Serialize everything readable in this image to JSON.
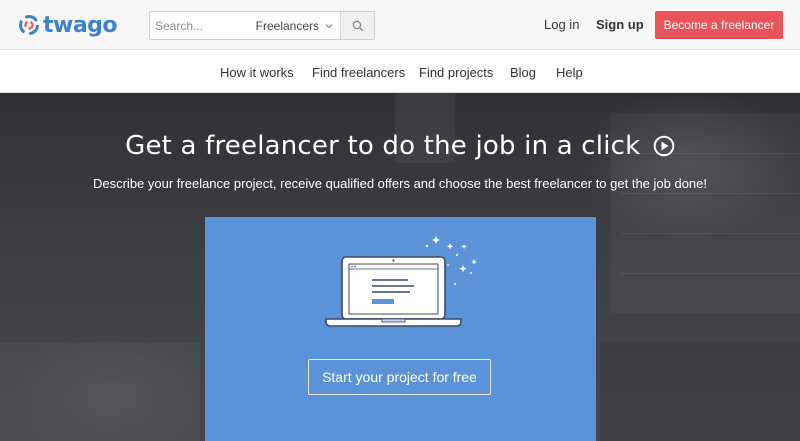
{
  "header": {
    "logo_text": "twago",
    "search": {
      "placeholder": "Search...",
      "category": "Freelancers"
    },
    "login": "Log in",
    "signup": "Sign up",
    "become_freelancer": "Become a freelancer"
  },
  "nav": {
    "items": [
      "How it works",
      "Find freelancers",
      "Find projects",
      "Blog",
      "Help"
    ]
  },
  "hero": {
    "title": "Get a freelancer to do the job in a click",
    "subtitle": "Describe your freelance project, receive qualified offers and choose the best freelancer to get the job done!",
    "cta": "Start your project for free"
  },
  "colors": {
    "brand_blue": "#3f82c9",
    "accent_red": "#e8545a",
    "card_blue": "#5b92d8"
  }
}
